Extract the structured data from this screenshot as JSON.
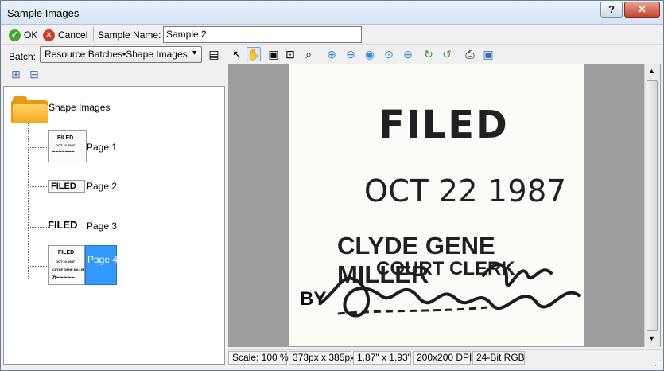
{
  "window": {
    "title": "Sample Images",
    "help": "?",
    "close": "✕"
  },
  "toolbar": {
    "ok_label": "OK",
    "cancel_label": "Cancel",
    "sample_name_label": "Sample Name:",
    "sample_name_value": "Sample 2",
    "batch_label": "Batch:",
    "batch_value": "Resource Batches•Shape Images"
  },
  "tree": {
    "root_label": "Shape Images",
    "pages": [
      {
        "label": "Page 1"
      },
      {
        "label": "Page 2"
      },
      {
        "label": "Page 3"
      },
      {
        "label": "Page 4",
        "selected": true
      }
    ]
  },
  "document": {
    "filed": "FILED",
    "date": "OCT 22 1987",
    "name": "CLYDE GENE MILLER",
    "title": "COURT CLERK",
    "by": "BY"
  },
  "status": {
    "scale": "Scale: 100 %",
    "pixels": "373px x 385px",
    "inches": "1.87\" x 1.93\"",
    "dpi": "200x200 DPI",
    "color": "24-Bit RGB"
  },
  "colors": {
    "ok": "#45a72f",
    "cancel": "#d53a25",
    "selected": "#3399ff",
    "folder": "#f5a71a"
  }
}
